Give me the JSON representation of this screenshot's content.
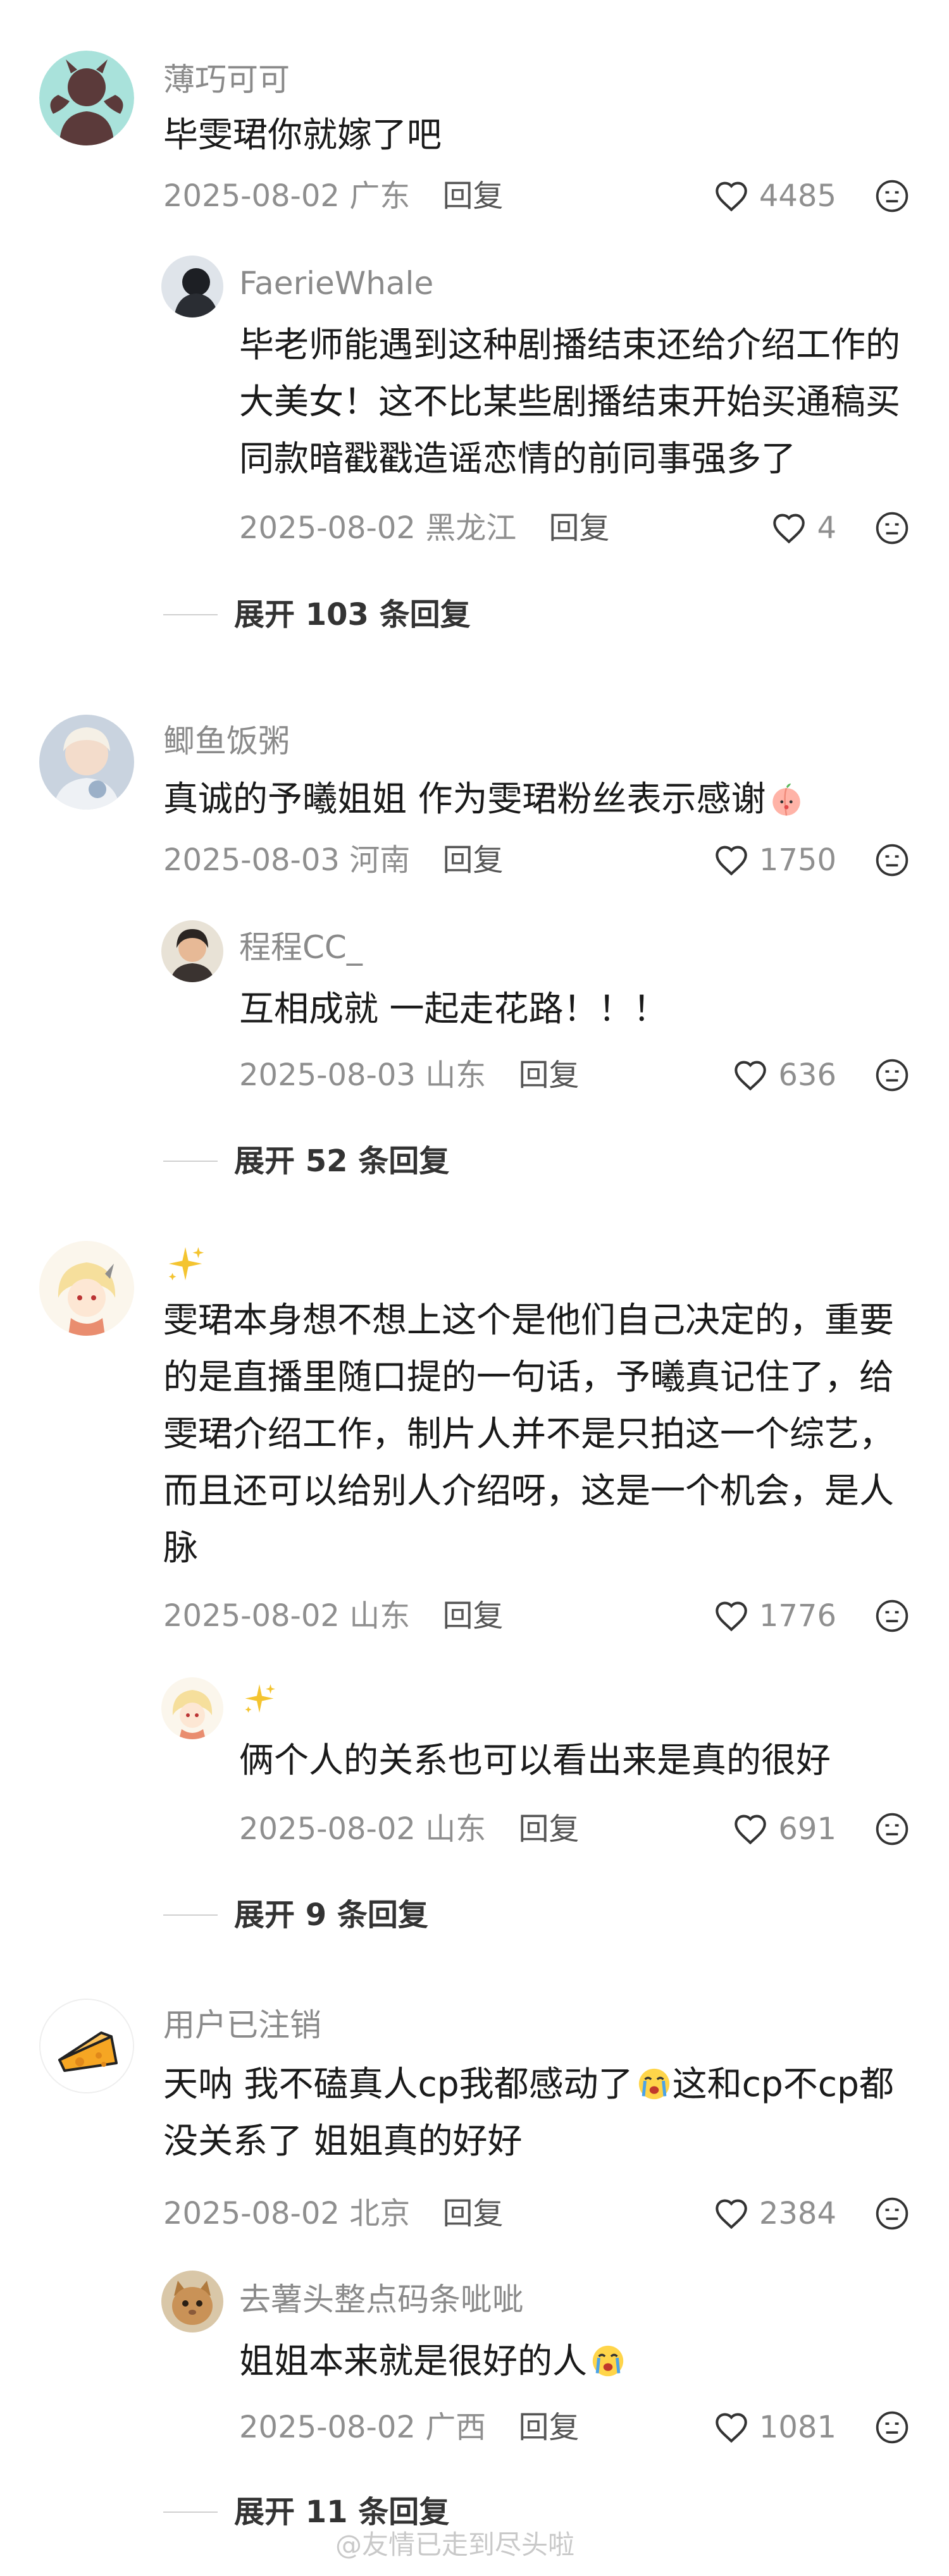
{
  "comments": [
    {
      "user": "薄巧可可",
      "text": "毕雯珺你就嫁了吧",
      "date": "2025-08-02",
      "location": "广东",
      "reply_label": "回复",
      "likes": "4485",
      "reply": {
        "user": "FaerieWhale",
        "text": "毕老师能遇到这种剧播结束还给介绍工作的大美女！这不比某些剧播结束开始买通稿买同款暗戳戳造谣恋情的前同事强多了",
        "date": "2025-08-02",
        "location": "黑龙江",
        "reply_label": "回复",
        "likes": "4"
      },
      "expand": "展开 103 条回复"
    },
    {
      "user": "鲫鱼饭粥",
      "text": "真诚的予曦姐姐 作为雯珺粉丝表示感谢",
      "date": "2025-08-03",
      "location": "河南",
      "reply_label": "回复",
      "likes": "1750",
      "reply": {
        "user": "程程CC_",
        "text": "互相成就 一起走花路！！！",
        "date": "2025-08-03",
        "location": "山东",
        "reply_label": "回复",
        "likes": "636"
      },
      "expand": "展开 52 条回复"
    },
    {
      "user": "",
      "text": "雯珺本身想不想上这个是他们自己决定的，重要的是直播里随口提的一句话，予曦真记住了，给雯珺介绍工作，制片人并不是只拍这一个综艺，而且还可以给别人介绍呀，这是一个机会，是人脉",
      "date": "2025-08-02",
      "location": "山东",
      "reply_label": "回复",
      "likes": "1776",
      "reply": {
        "user": "",
        "text": "俩个人的关系也可以看出来是真的很好",
        "date": "2025-08-02",
        "location": "山东",
        "reply_label": "回复",
        "likes": "691"
      },
      "expand": "展开 9 条回复"
    },
    {
      "user": "用户已注销",
      "text_a": "天呐 我不磕真人cp我都感动了",
      "text_b": "这和cp不cp都没关系了 姐姐真的好好",
      "date": "2025-08-02",
      "location": "北京",
      "reply_label": "回复",
      "likes": "2384",
      "reply": {
        "user": "去薯头整点码条呲呲",
        "text": "姐姐本来就是很好的人",
        "date": "2025-08-02",
        "location": "广西",
        "reply_label": "回复",
        "likes": "1081"
      },
      "expand": "展开 11 条回复"
    }
  ],
  "watermark": "@友情已走到尽头啦",
  "icons": {
    "like": "heart-outline-icon",
    "dislike": "unhappy-face-icon",
    "sparkle": "sparkle-icon"
  },
  "colors": {
    "username": "#8a8a8a",
    "meta": "#8f8f8f",
    "text": "#1a1a1a"
  }
}
